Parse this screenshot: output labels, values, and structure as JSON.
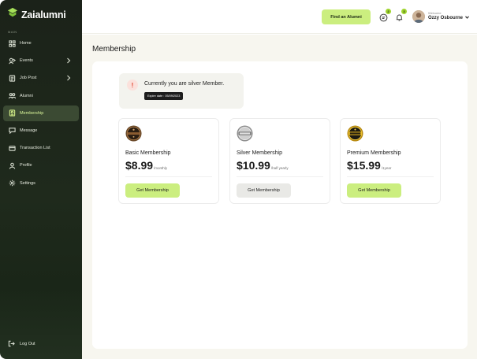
{
  "app": {
    "name": "Zaialumni",
    "section_label": "MAIN"
  },
  "sidebar": {
    "items": [
      {
        "label": "Home",
        "icon": "grid-icon",
        "chevron": false,
        "active": false
      },
      {
        "label": "Events",
        "icon": "events-icon",
        "chevron": true,
        "active": false
      },
      {
        "label": "Job Post",
        "icon": "document-icon",
        "chevron": true,
        "active": false
      },
      {
        "label": "Alumni",
        "icon": "users-icon",
        "chevron": false,
        "active": false
      },
      {
        "label": "Membership",
        "icon": "membership-icon",
        "chevron": false,
        "active": true
      },
      {
        "label": "Message",
        "icon": "message-icon",
        "chevron": false,
        "active": false
      },
      {
        "label": "Transaction List",
        "icon": "card-icon",
        "chevron": false,
        "active": false
      },
      {
        "label": "Profile",
        "icon": "user-icon",
        "chevron": false,
        "active": false
      },
      {
        "label": "Settings",
        "icon": "gear-icon",
        "chevron": false,
        "active": false
      }
    ],
    "logout": "Log Out"
  },
  "header": {
    "find_button": "Find an Alumni",
    "message_badge": "2",
    "notification_badge": "3",
    "welcome": "Welcome",
    "user_name": "Ozzy Osbourne"
  },
  "main": {
    "title": "Membership",
    "alert": {
      "text": "Currently you are silver Member.",
      "expire": "Expire date : 05/09/2023",
      "icon": "!"
    },
    "plans": [
      {
        "name": "Basic Membership",
        "price": "$8.99",
        "period": "/monthly",
        "button": "Get Membership",
        "medal": "basic-medal-icon"
      },
      {
        "name": "Silver Membership",
        "price": "$10.99",
        "period": "/half yearly",
        "button": "Get Membership",
        "medal": "silver-medal-icon"
      },
      {
        "name": "Premium Membership",
        "price": "$15.99",
        "period": "/1year",
        "button": "Get Membership",
        "medal": "premium-medal-icon"
      }
    ]
  },
  "colors": {
    "accent": "#cbee7f",
    "sidebar_bg": "#1f2a1c",
    "active_text": "#d9f59a"
  }
}
